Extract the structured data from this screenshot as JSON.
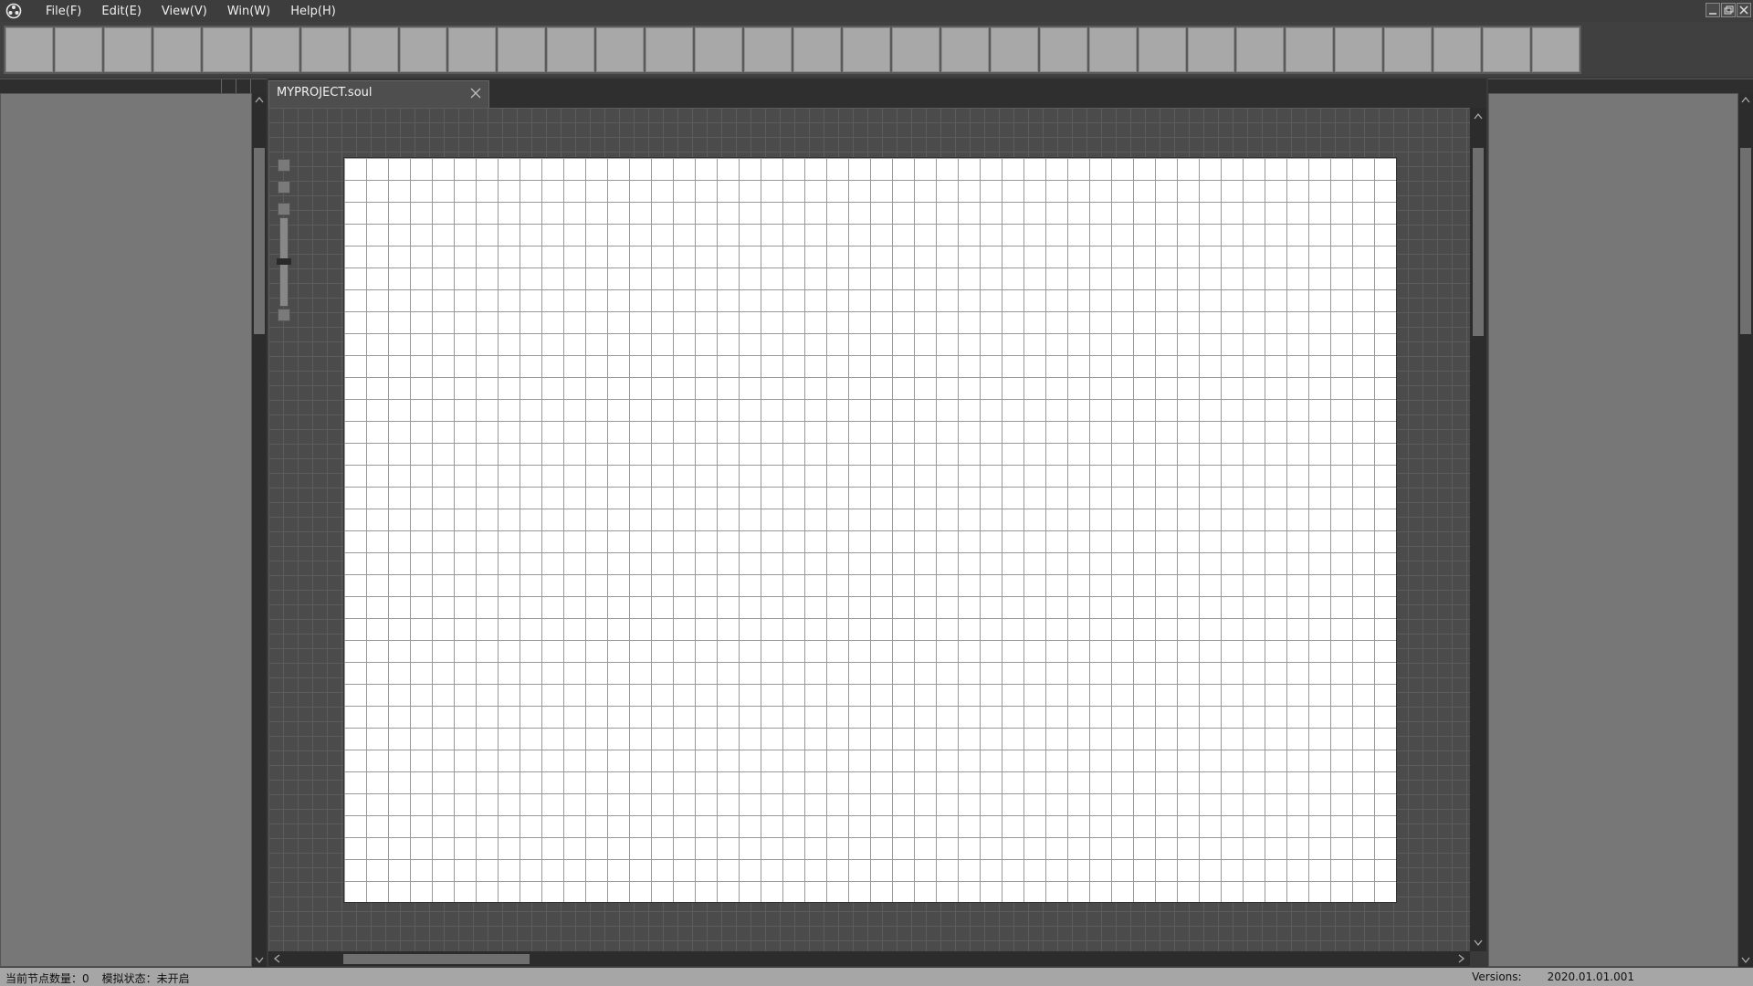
{
  "menu": {
    "items": [
      {
        "label": "File(F)"
      },
      {
        "label": "Edit(E)"
      },
      {
        "label": "View(V)"
      },
      {
        "label": "Win(W)"
      },
      {
        "label": "Help(H)"
      }
    ]
  },
  "window_controls": [
    "minimize-icon",
    "restore-icon",
    "close-icon"
  ],
  "toolbar": {
    "button_count": 32
  },
  "document": {
    "tab_label": "MYPROJECT.soul"
  },
  "status": {
    "node_count_label": "当前节点数量：0",
    "sim_state_label": "模拟状态：未开启",
    "versions_label": "Versions:",
    "versions_value": "2020.01.01.001"
  },
  "colors": {
    "background": "#3a3a3a",
    "panel": "#777777",
    "workspace": "#4b4b4b",
    "canvas": "#ffffff",
    "statusbar": "#a6a6a6"
  }
}
